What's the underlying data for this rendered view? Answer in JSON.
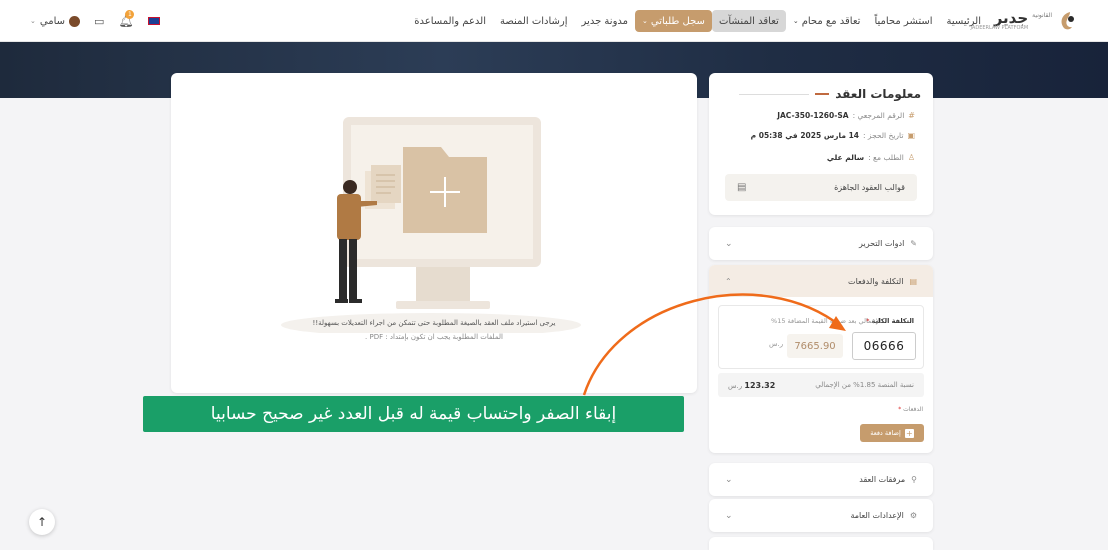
{
  "nav": {
    "home": "الرئيسية",
    "consult": "استشر محامياً",
    "contract_lawyer": "تعاقد مع محام",
    "contract_facilities": "تعاقد المنشآت",
    "my_record": "سجل طلباتي",
    "blog": "مدونة جدير",
    "guidelines": "إرشادات المنصة",
    "support": "الدعم والمساعدة"
  },
  "logo": {
    "name": "جدير",
    "tag": "القانونية",
    "sub": "JADEERLAW PLATFORM"
  },
  "user": {
    "name": "سامي",
    "notif_count": "1"
  },
  "upload": {
    "hint": "يرجى استيراد ملف العقد بالصيغة المطلوبة حتى تتمكن من اجراء التعديلات بسهولة!!",
    "formats": "الملفات المطلوبة يجب ان تكون بإمتداد : PDF ."
  },
  "info": {
    "title": "معلومات العقد",
    "ref_label": "الرقم المرجعي :",
    "ref_value": "JAC-350-1260-SA",
    "date_label": "تاريخ الحجز :",
    "date_value": "14 مارس 2025 في 05:38 م",
    "party_label": "الطلب مع :",
    "party_value": "سالم علي",
    "templates": "قوالب العقود الجاهزة"
  },
  "sections": {
    "edit_tools": "ادوات التحرير",
    "cost": "التكلفة والدفعات",
    "attachments": "مرفقات العقد",
    "general": "الإعدادات العامة"
  },
  "payment": {
    "total_label": "التكلفة الكلية",
    "total_value": "06666",
    "vat_label": "الإجمالي بعد ضريبة القيمة المضافة 15%",
    "vat_value": "7665.90",
    "currency": "ر.س",
    "fee_label": "نسبة المنصة 1.85% من الإجمالي",
    "fee_value": "123.32",
    "installments_label": "الدفعات",
    "add_installment": "إضافة دفعة"
  },
  "caption": "إبقاء الصفر واحتساب قيمة له قبل العدد غير صحيح حسابيا",
  "colors": {
    "accent": "#c69c6d",
    "annotation_green": "#1a9f68",
    "annotation_arrow": "#ef6b1a"
  }
}
